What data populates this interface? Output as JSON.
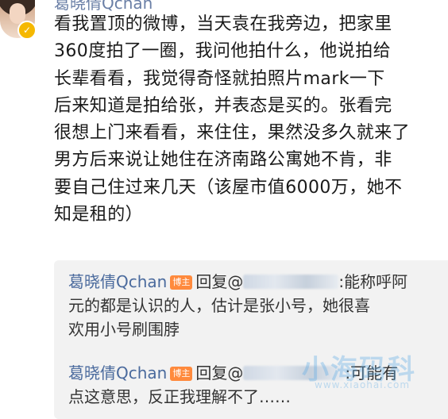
{
  "author": {
    "name": "葛晓倩Qchan"
  },
  "post": {
    "lines": [
      "看我置顶的微博，当天袁在我旁边，把家里",
      "360度拍了一圈，我问他拍什么，他说拍给",
      "长辈看看，我觉得奇怪就拍照片mark一下",
      "后来知道是拍给张，并表态是买的。张看完",
      "很想上门来看看，来住住，果然没多久就来了",
      "男方后来说让她住在济南路公寓她不肯，非",
      "要自己住过来几天（该屋市值6000万，她不",
      "知是租的）"
    ]
  },
  "replies": [
    {
      "name": "葛晓倩Qchan",
      "badge": "博主",
      "prefix": "回复@",
      "tail": ":能称呼阿",
      "line2": "元的都是认识的人，估计是张小号，她很喜",
      "line3": "欢用小号刷围脖"
    },
    {
      "name": "葛晓倩Qchan",
      "badge": "博主",
      "prefix": "回复@",
      "tail": ":可能有",
      "line2": "点这意思，反正我理解不了……"
    }
  ],
  "watermark": {
    "text": "小海码科",
    "url": "www.xiaohai.com"
  },
  "colors": {
    "name_link": "#4a6a9d",
    "badge": "#ff8a3d",
    "verified": "#f5b800"
  }
}
